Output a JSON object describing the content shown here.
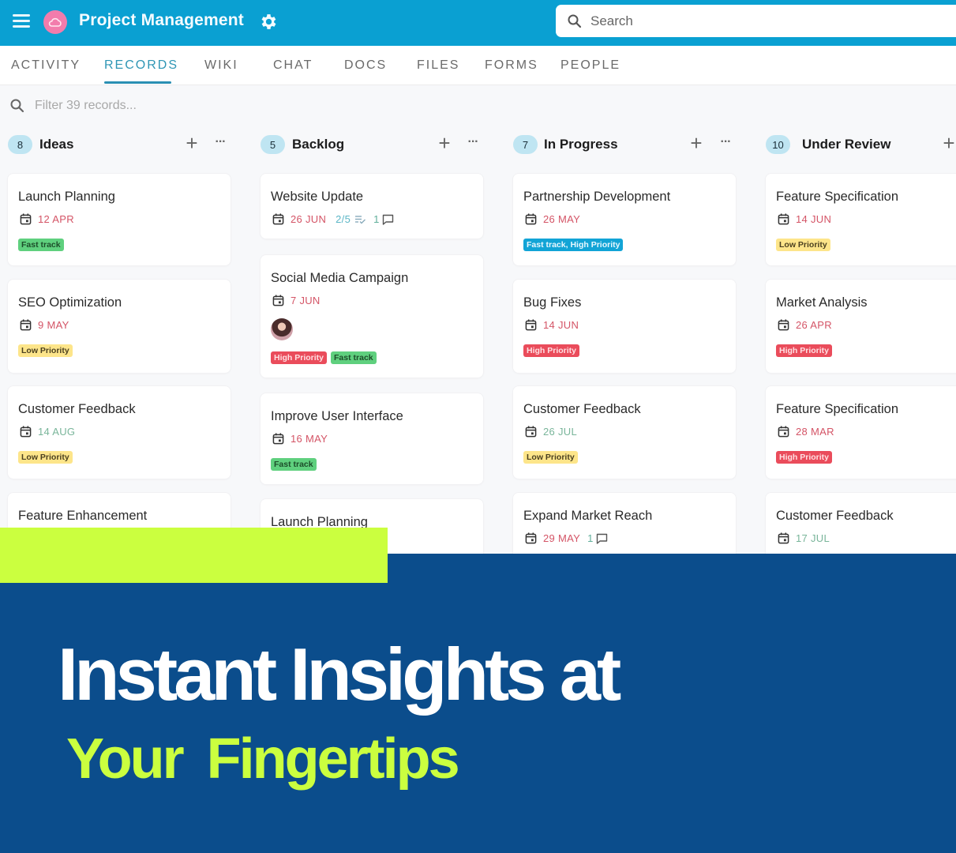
{
  "header": {
    "app_title": "Project Management",
    "logo_icon": "cloud-icon",
    "search_placeholder": "Search",
    "colors": {
      "bar": "#0aa0d2",
      "logo": "#f27cac"
    }
  },
  "tabs": [
    {
      "label": "ACTIVITY",
      "active": false
    },
    {
      "label": "RECORDS",
      "active": true
    },
    {
      "label": "WIKI",
      "active": false
    },
    {
      "label": "CHAT",
      "active": false
    },
    {
      "label": "DOCS",
      "active": false
    },
    {
      "label": "FILES",
      "active": false
    },
    {
      "label": "FORMS",
      "active": false
    },
    {
      "label": "PEOPLE",
      "active": false
    }
  ],
  "filter": {
    "placeholder": "Filter 39 records..."
  },
  "columns": [
    {
      "title": "Ideas",
      "count": "8",
      "cards": [
        {
          "title": "Launch Planning",
          "date": "12 APR",
          "tags": [
            "Fast track"
          ]
        },
        {
          "title": "SEO Optimization",
          "date": "9 MAY",
          "tags": [
            "Low Priority"
          ]
        },
        {
          "title": "Customer Feedback",
          "date": "14 AUG",
          "tags": [
            "Low Priority"
          ]
        },
        {
          "title": "Feature Enhancement"
        }
      ]
    },
    {
      "title": "Backlog",
      "count": "5",
      "cards": [
        {
          "title": "Website Update",
          "date": "26 JUN",
          "checklist": "2/5",
          "comments": "1"
        },
        {
          "title": "Social Media Campaign",
          "date": "7 JUN",
          "tags": [
            "High Priority",
            "Fast track"
          ],
          "has_avatar": true
        },
        {
          "title": "Improve User Interface",
          "date": "16 MAY",
          "tags": [
            "Fast track"
          ]
        },
        {
          "title": "Launch Planning"
        }
      ]
    },
    {
      "title": "In Progress",
      "count": "7",
      "cards": [
        {
          "title": "Partnership Development",
          "date": "26 MAY",
          "tags": [
            "Fast track, High Priority"
          ]
        },
        {
          "title": "Bug Fixes",
          "date": "14 JUN",
          "tags": [
            "High Priority"
          ]
        },
        {
          "title": "Customer Feedback",
          "date": "26 JUL",
          "tags": [
            "Low Priority"
          ]
        },
        {
          "title": "Expand Market Reach",
          "date": "29 MAY",
          "comments": "1"
        }
      ]
    },
    {
      "title": "Under Review",
      "count": "10",
      "cards": [
        {
          "title": "Feature Specification",
          "date": "14 JUN",
          "tags": [
            "Low Priority"
          ]
        },
        {
          "title": "Market Analysis",
          "date": "26 APR",
          "tags": [
            "High Priority"
          ]
        },
        {
          "title": "Feature Specification",
          "date": "28 MAR",
          "tags": [
            "High Priority"
          ]
        },
        {
          "title": "Customer Feedback",
          "date": "17 JUL"
        }
      ]
    }
  ],
  "banner": {
    "headline": "Instant Insights at",
    "subheadline": "Your Fingertips",
    "colors": {
      "background": "#0b4d8c",
      "accent": "#cbff3f",
      "headline": "#ffffff"
    }
  }
}
